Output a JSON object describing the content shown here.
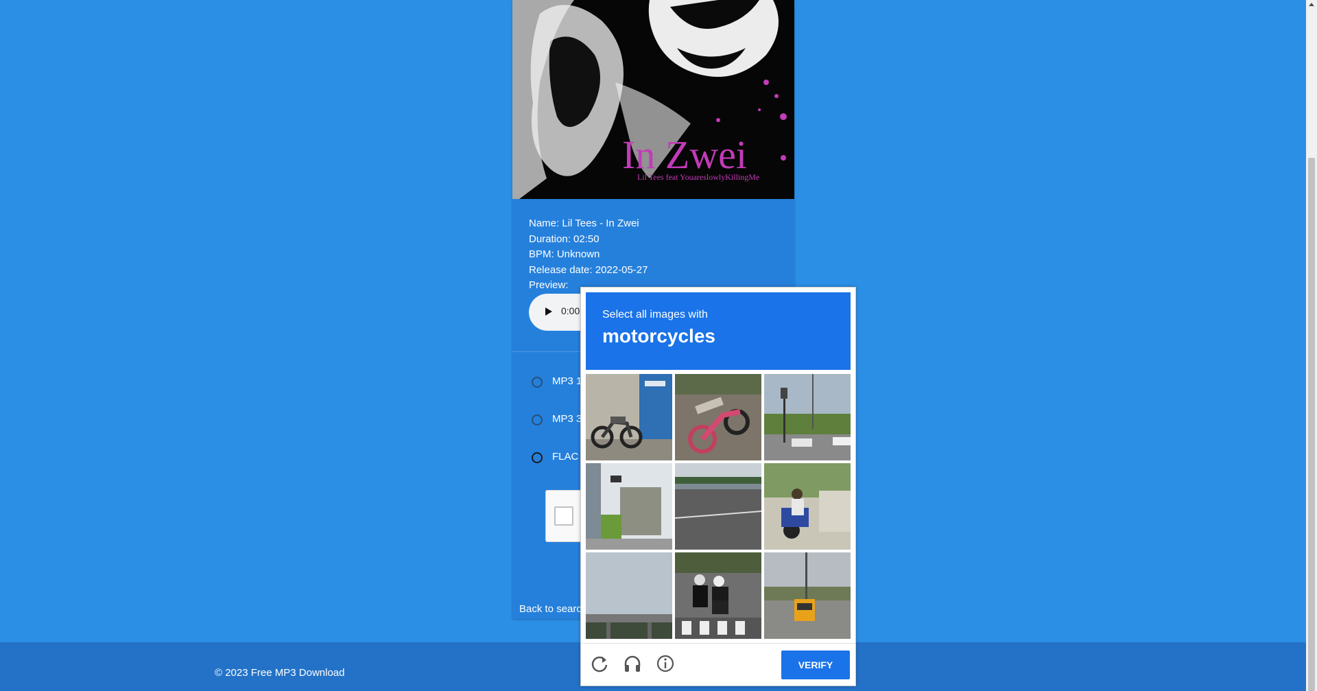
{
  "track": {
    "name": "Name: Lil Tees - In Zwei",
    "duration": "Duration: 02:50",
    "bpm": "BPM: Unknown",
    "release": "Release date: 2022-05-27",
    "preview_label": "Preview:",
    "cover_title": "In Zwei",
    "cover_subtitle": "Lil Tees feat YouareslowlyKillingMe"
  },
  "player": {
    "time": "0:00"
  },
  "formats": [
    {
      "label": "MP3 12",
      "selected": false
    },
    {
      "label": "MP3 32",
      "selected": false
    },
    {
      "label": "FLAC (",
      "selected": true
    }
  ],
  "nav": {
    "back_label": "Back to searc"
  },
  "footer": {
    "copyright": "© 2023 Free MP3 Download"
  },
  "captcha": {
    "instruction": "Select all images with",
    "target": "motorcycles",
    "verify_label": "VERIFY",
    "tiles": [
      "motorcycle parked by blue storefront",
      "motorcycle lying on pavement",
      "street intersection with traffic light",
      "building with billboard",
      "road with overpass",
      "person riding scooter",
      "sky and overpass",
      "riders on motorcycles at crosswalk",
      "school bus on highway"
    ]
  },
  "icons": [
    "reload-icon",
    "headphones-icon",
    "info-icon"
  ],
  "colors": {
    "background": "#2c8fe6",
    "card": "#2580dc",
    "footer": "#2372c8",
    "captcha_accent": "#1a73e8"
  }
}
